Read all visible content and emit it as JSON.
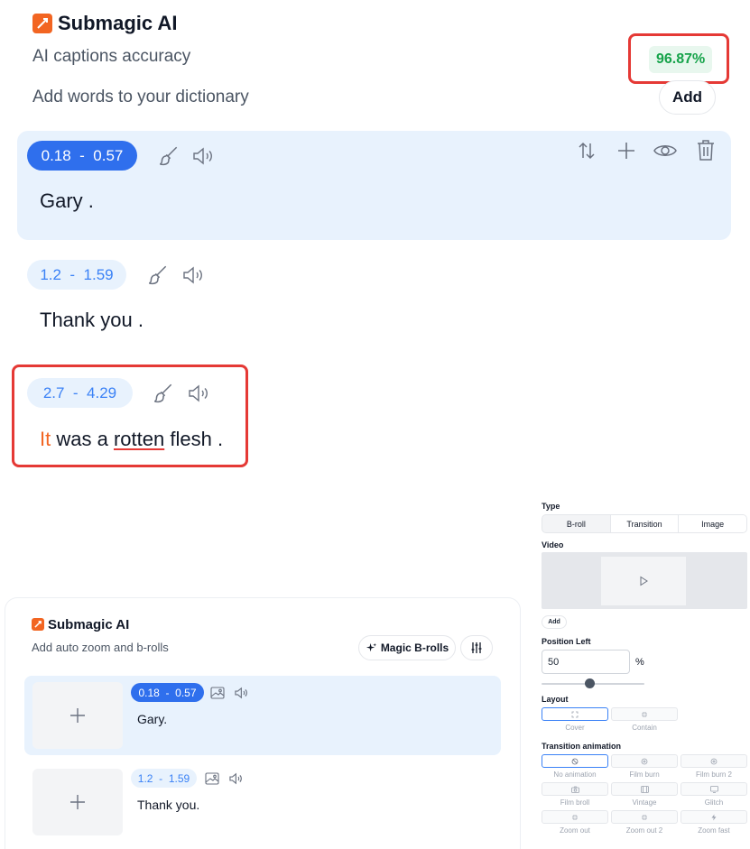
{
  "top": {
    "brand": "Submagic AI",
    "accuracy_label": "AI captions accuracy",
    "accuracy_value": "96.87%",
    "dictionary_label": "Add words to your dictionary",
    "add_label": "Add",
    "segments": [
      {
        "time_start": "0.18",
        "time_end": "0.57",
        "text": "Gary ."
      },
      {
        "time_start": "1.2",
        "time_end": "1.59",
        "text": "Thank you ."
      },
      {
        "time_start": "2.7",
        "time_end": "4.29",
        "words": [
          "It",
          "was a",
          "rotten",
          "flesh ."
        ]
      }
    ]
  },
  "broll": {
    "brand": "Submagic AI",
    "subtitle": "Add auto zoom and b-rolls",
    "magic_label": "Magic B-rolls",
    "segments": [
      {
        "time_start": "0.18",
        "time_end": "0.57",
        "text": "Gary."
      },
      {
        "time_start": "1.2",
        "time_end": "1.59",
        "text": "Thank you."
      }
    ]
  },
  "settings": {
    "type_label": "Type",
    "type_options": [
      "B-roll",
      "Transition",
      "Image"
    ],
    "type_selected": "Transition",
    "video_label": "Video",
    "add_label": "Add",
    "position_label": "Position Left",
    "position_value": "50",
    "position_unit": "%",
    "slider_level": 0.47,
    "layout_label": "Layout",
    "layout_options": [
      "Cover",
      "Contain"
    ],
    "transition_label": "Transition animation",
    "transition_options": [
      "No animation",
      "Film burn",
      "Film burn 2",
      "Film broll",
      "Vintage",
      "Glitch",
      "Zoom out",
      "Zoom out 2",
      "Zoom fast"
    ]
  },
  "colors": {
    "brand_orange": "#f26522",
    "accent_blue": "#2f6fed",
    "highlight_red": "#e53935",
    "accuracy_green": "#16a34a"
  }
}
